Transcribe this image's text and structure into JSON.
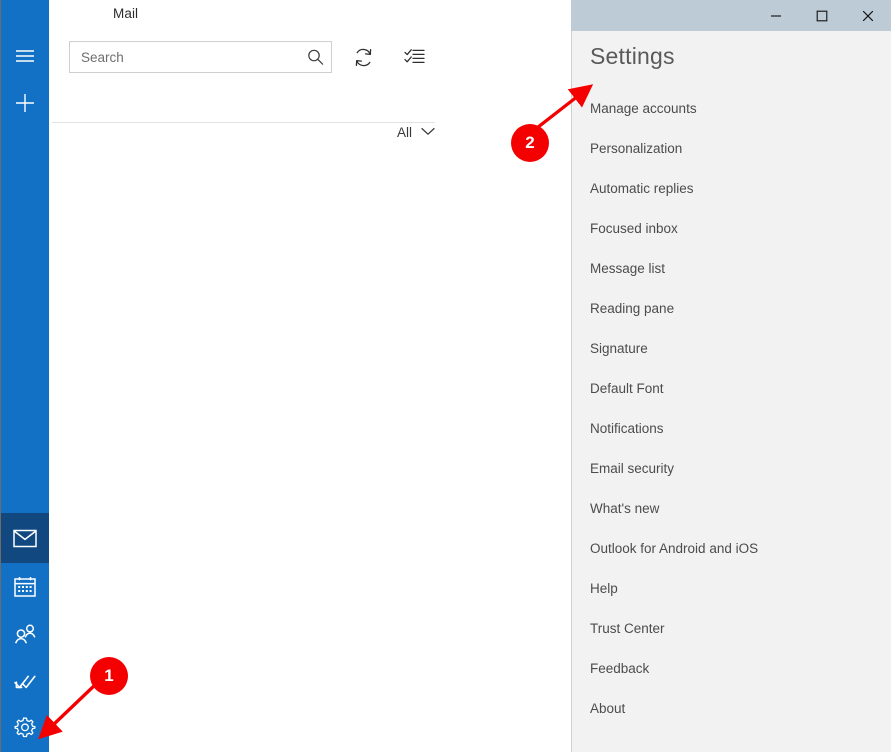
{
  "window": {
    "title_bar": {
      "background": "#bccbd6",
      "controls": [
        {
          "name": "minimize",
          "label": "—",
          "icon": "minimize-icon"
        },
        {
          "name": "maximize",
          "label": "□",
          "icon": "maximize-icon"
        },
        {
          "name": "close",
          "label": "✕",
          "icon": "close-icon"
        }
      ]
    }
  },
  "mail": {
    "app_title": "Mail",
    "accent_color": "#1271c4",
    "selected_accent_color": "#10487f",
    "search": {
      "placeholder": "Search",
      "value": "",
      "icon": "search-icon"
    },
    "toolbar": [
      {
        "name": "sync",
        "icon": "sync-icon",
        "tooltip": "Sync this view"
      },
      {
        "name": "selection-mode",
        "icon": "checklist-icon",
        "tooltip": "Enter selection mode"
      }
    ],
    "filter": {
      "label": "All",
      "icon": "chevron-down-icon"
    },
    "nav_rail": [
      {
        "name": "menu",
        "icon": "hamburger-icon",
        "label": "Expand navigation pane",
        "selected": false
      },
      {
        "name": "new-mail",
        "icon": "plus-icon",
        "label": "New mail",
        "selected": false
      },
      {
        "name": "mail",
        "icon": "envelope-icon",
        "label": "Mail",
        "selected": true
      },
      {
        "name": "calendar",
        "icon": "calendar-icon",
        "label": "Calendar",
        "selected": false
      },
      {
        "name": "people",
        "icon": "people-icon",
        "label": "People",
        "selected": false
      },
      {
        "name": "to-do",
        "icon": "todo-check-icon",
        "label": "To Do",
        "selected": false
      },
      {
        "name": "settings",
        "icon": "gear-icon",
        "label": "Settings",
        "selected": false
      }
    ]
  },
  "settings": {
    "title": "Settings",
    "background": "#f2f2f2",
    "items": [
      {
        "label": "Manage accounts"
      },
      {
        "label": "Personalization"
      },
      {
        "label": "Automatic replies"
      },
      {
        "label": "Focused inbox"
      },
      {
        "label": "Message list"
      },
      {
        "label": "Reading pane"
      },
      {
        "label": "Signature"
      },
      {
        "label": "Default Font"
      },
      {
        "label": "Notifications"
      },
      {
        "label": "Email security"
      },
      {
        "label": "What's new"
      },
      {
        "label": "Outlook for Android and iOS"
      },
      {
        "label": "Help"
      },
      {
        "label": "Trust Center"
      },
      {
        "label": "Feedback"
      },
      {
        "label": "About"
      }
    ]
  },
  "annotations": {
    "color": "#f50000",
    "markers": [
      {
        "number": "1",
        "points_to": "settings-gear-icon"
      },
      {
        "number": "2",
        "points_to": "settings-item-manage-accounts"
      }
    ]
  }
}
